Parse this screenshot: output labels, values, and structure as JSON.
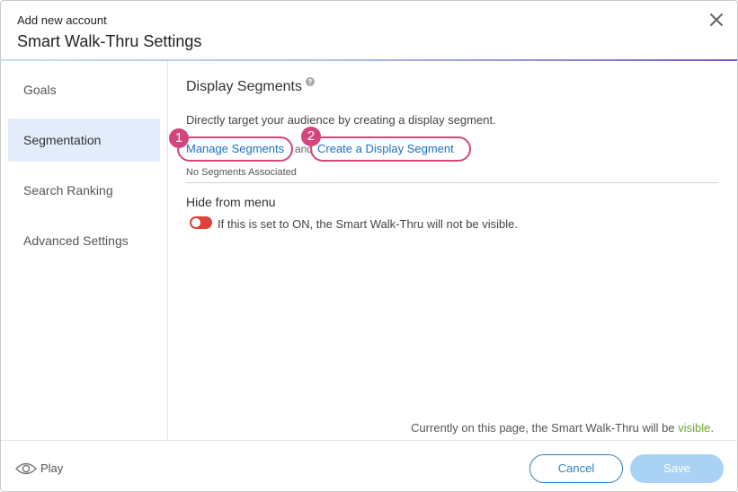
{
  "header": {
    "subtitle": "Add new account",
    "title": "Smart Walk-Thru Settings",
    "close_icon": "close-icon"
  },
  "sidebar": {
    "items": [
      {
        "label": "Goals",
        "active": false
      },
      {
        "label": "Segmentation",
        "active": true
      },
      {
        "label": "Search Ranking",
        "active": false
      },
      {
        "label": "Advanced Settings",
        "active": false
      }
    ]
  },
  "segments": {
    "title": "Display Segments",
    "help_icon": "question-circle-icon",
    "description": "Directly target your audience by creating a display segment.",
    "manage_link": "Manage Segments",
    "and_text": "and",
    "create_link": "Create a Display Segment",
    "no_segments": "No Segments Associated",
    "callouts": [
      "1",
      "2"
    ],
    "callout_color": "#d4457c"
  },
  "hide_menu": {
    "title": "Hide from menu",
    "toggle_state": "off",
    "toggle_color": "#e0423b",
    "description": "If this is set to ON, the Smart Walk-Thru will not be visible."
  },
  "status": {
    "prefix": "Currently on this page, the Smart Walk-Thru will be ",
    "value": "visible",
    "suffix": ".",
    "value_color": "#6aaa2a"
  },
  "footer": {
    "play_label": "Play",
    "play_icon": "eye-icon",
    "cancel_label": "Cancel",
    "save_label": "Save"
  },
  "colors": {
    "accent": "#2d83c6",
    "link": "#1a6fc9",
    "save_disabled": "#a9d2f5"
  }
}
